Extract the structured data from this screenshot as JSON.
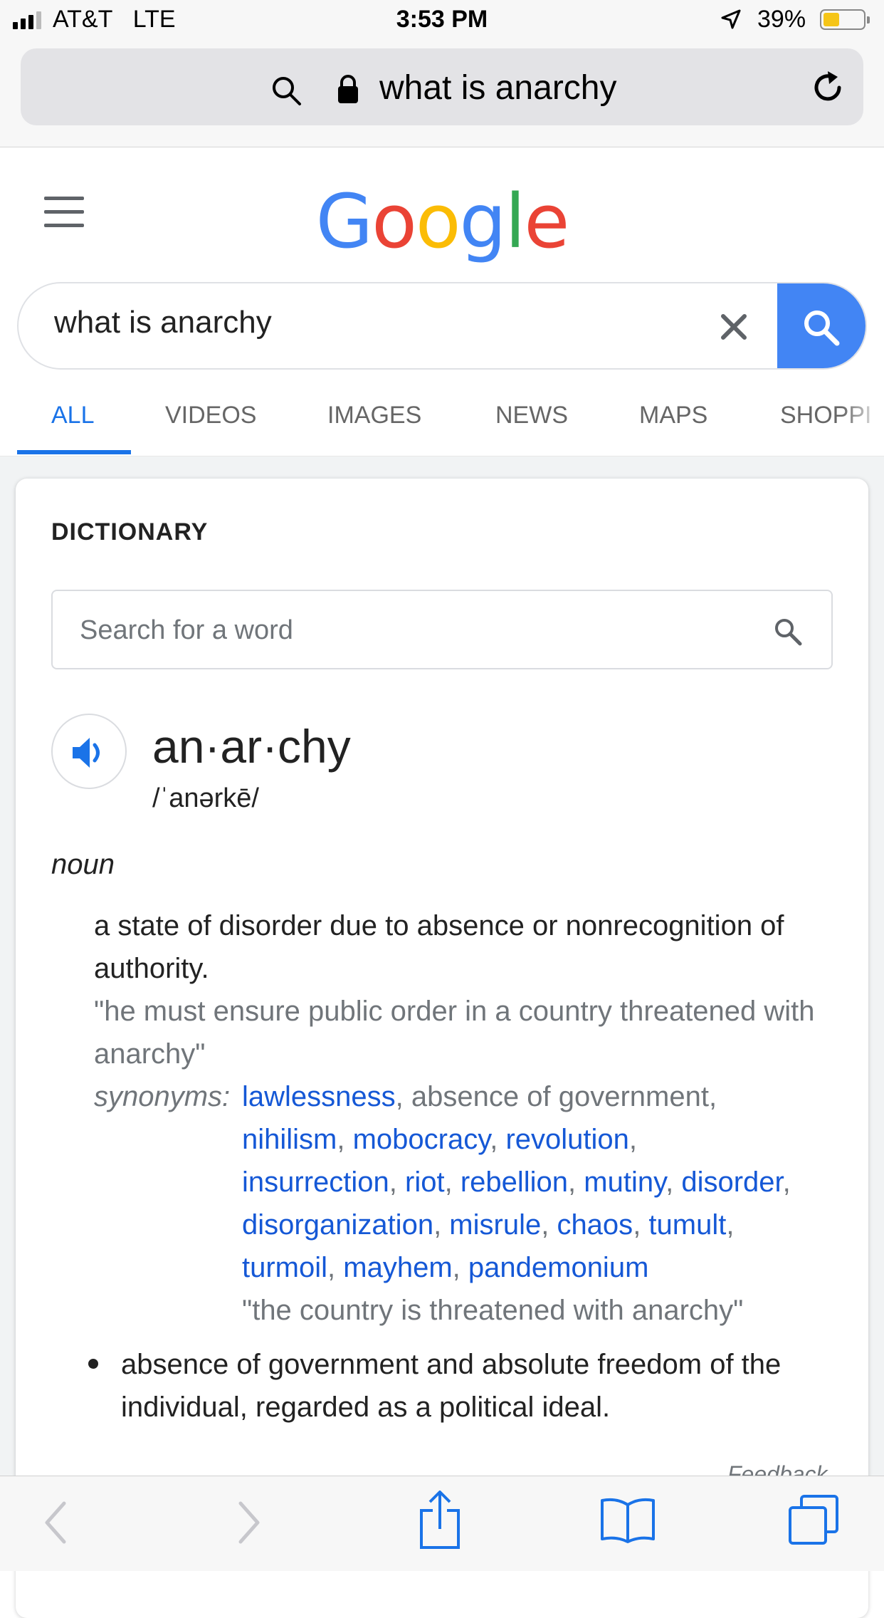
{
  "status_bar": {
    "carrier": "AT&T",
    "network": "LTE",
    "time": "3:53 PM",
    "battery": "39%",
    "battery_level": 0.39
  },
  "browser": {
    "url_text": "what is anarchy",
    "icons": [
      "search-icon",
      "lock-icon",
      "reload-icon"
    ]
  },
  "google": {
    "logo_letters": [
      "G",
      "o",
      "o",
      "g",
      "l",
      "e"
    ],
    "search_query": "what is anarchy",
    "tabs": [
      "ALL",
      "VIDEOS",
      "IMAGES",
      "NEWS",
      "MAPS",
      "SHOPPI"
    ],
    "active_tab": "ALL"
  },
  "dictionary": {
    "title": "DICTIONARY",
    "search_placeholder": "Search for a word",
    "word": "an·ar·chy",
    "phonetic": "/ˈanərkē/",
    "part_of_speech": "noun",
    "definition_1": "a state of disorder due to absence or nonrecognition of authority.",
    "example_1": "\"he must ensure public order in a country threatened with anarchy\"",
    "synonyms_label": "synonyms:",
    "synonyms": [
      "lawlessness",
      "absence of government",
      "nihilism",
      "mobocracy",
      "revolution",
      "insurrection",
      "riot",
      "rebellion",
      "mutiny",
      "disorder",
      "disorganization",
      "misrule",
      "chaos",
      "tumult",
      "turmoil",
      "mayhem",
      "pandemonium"
    ],
    "synonym_example": "\"the country is threatened with anarchy\"",
    "definition_2": "absence of government and absolute freedom of the individual, regarded as a political ideal.",
    "feedback": "Feedback"
  },
  "colors": {
    "accent_blue": "#1a73e8",
    "link_blue": "#1558d6",
    "google_blue": "#4285f4",
    "battery_yellow": "#f5c518"
  }
}
